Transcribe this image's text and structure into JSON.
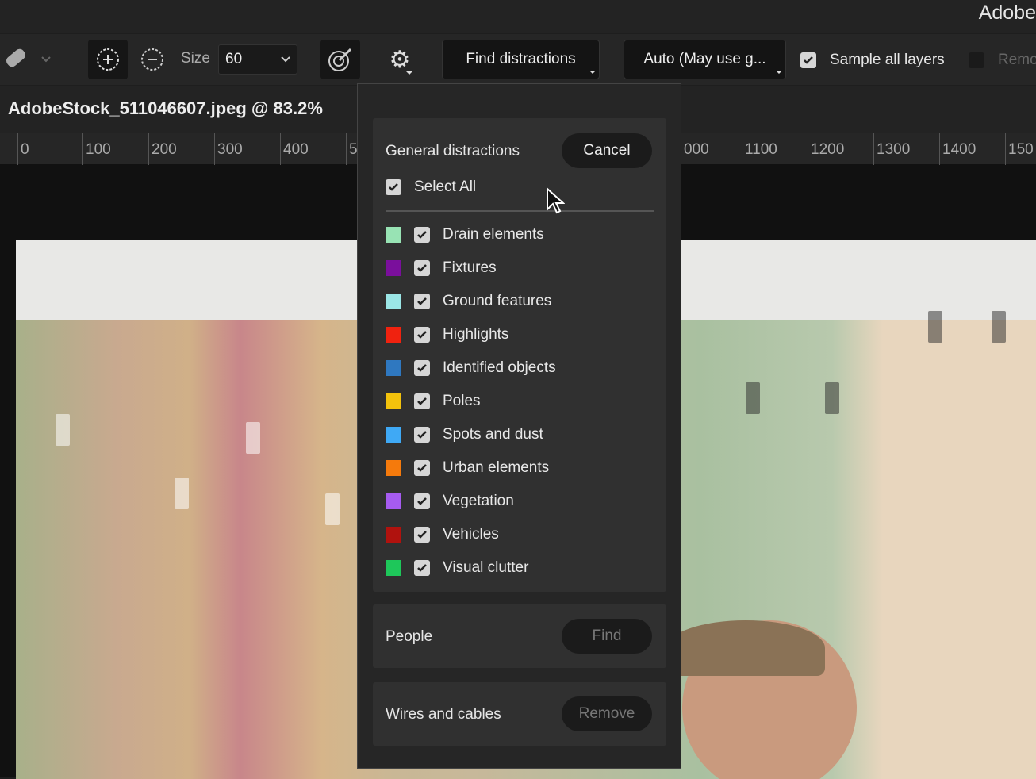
{
  "app": {
    "title": "Adobe"
  },
  "toolbar": {
    "size_label": "Size",
    "size_value": "60",
    "find_distractions": "Find distractions",
    "mode": "Auto (May use g...",
    "sample_all_layers": "Sample all layers",
    "remove_label": "Remo",
    "sample_checked": true
  },
  "document": {
    "tab": "AdobeStock_511046607.jpeg @ 83.2%"
  },
  "ruler": {
    "labels": [
      "0",
      "100",
      "200",
      "300",
      "400",
      "5",
      "000",
      "1100",
      "1200",
      "1300",
      "1400",
      "150"
    ]
  },
  "popup": {
    "general": {
      "title": "General distractions",
      "cancel": "Cancel",
      "select_all": "Select All",
      "items": [
        {
          "label": "Drain elements",
          "color": "#98e3b4"
        },
        {
          "label": "Fixtures",
          "color": "#7a0f9c"
        },
        {
          "label": "Ground features",
          "color": "#9be6e6"
        },
        {
          "label": "Highlights",
          "color": "#f0220f"
        },
        {
          "label": "Identified objects",
          "color": "#2f78c0"
        },
        {
          "label": "Poles",
          "color": "#f3c20c"
        },
        {
          "label": "Spots and dust",
          "color": "#3fa9f5"
        },
        {
          "label": "Urban elements",
          "color": "#f57a0c"
        },
        {
          "label": "Vegetation",
          "color": "#a65bf0"
        },
        {
          "label": "Vehicles",
          "color": "#b0120e"
        },
        {
          "label": "Visual clutter",
          "color": "#1ec75a"
        }
      ]
    },
    "people": {
      "label": "People",
      "button": "Find"
    },
    "wires": {
      "label": "Wires and cables",
      "button": "Remove"
    }
  }
}
